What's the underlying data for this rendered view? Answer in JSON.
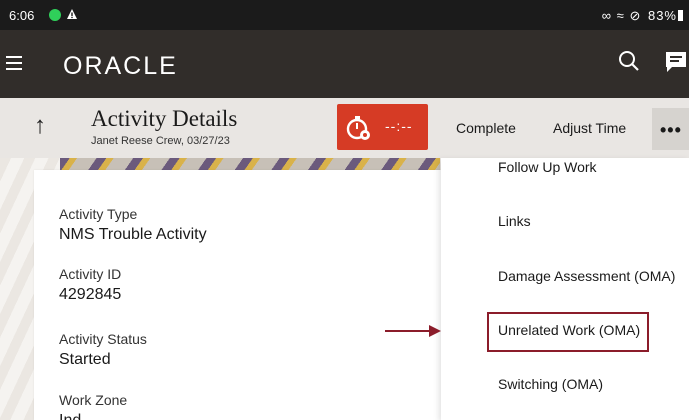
{
  "status_bar": {
    "time": "6:06",
    "battery": "83%"
  },
  "app_header": {
    "logo": "ORACLE"
  },
  "activity_header": {
    "title": "Activity Details",
    "subtitle": "Janet Reese Crew, 03/27/23",
    "timer_value": "--:--",
    "timer_color": "#d63b25",
    "actions": {
      "complete": "Complete",
      "adjust_time": "Adjust Time",
      "more": "•••"
    }
  },
  "details": {
    "fields": [
      {
        "label": "Activity Type",
        "value": "NMS Trouble Activity"
      },
      {
        "label": "Activity ID",
        "value": "4292845"
      },
      {
        "label": "Activity Status",
        "value": "Started"
      },
      {
        "label": "Work Zone",
        "value": "Ind"
      }
    ]
  },
  "dropdown_menu": {
    "items": [
      {
        "label": "Follow Up Work"
      },
      {
        "label": "Links"
      },
      {
        "label": "Damage Assessment (OMA)"
      },
      {
        "label": "Unrelated Work (OMA)",
        "highlighted": true
      },
      {
        "label": "Switching (OMA)"
      }
    ]
  },
  "colors": {
    "header_bg": "#312d2a",
    "highlight_border": "#8b1c2a",
    "annotation_arrow": "#8b1c2a"
  }
}
